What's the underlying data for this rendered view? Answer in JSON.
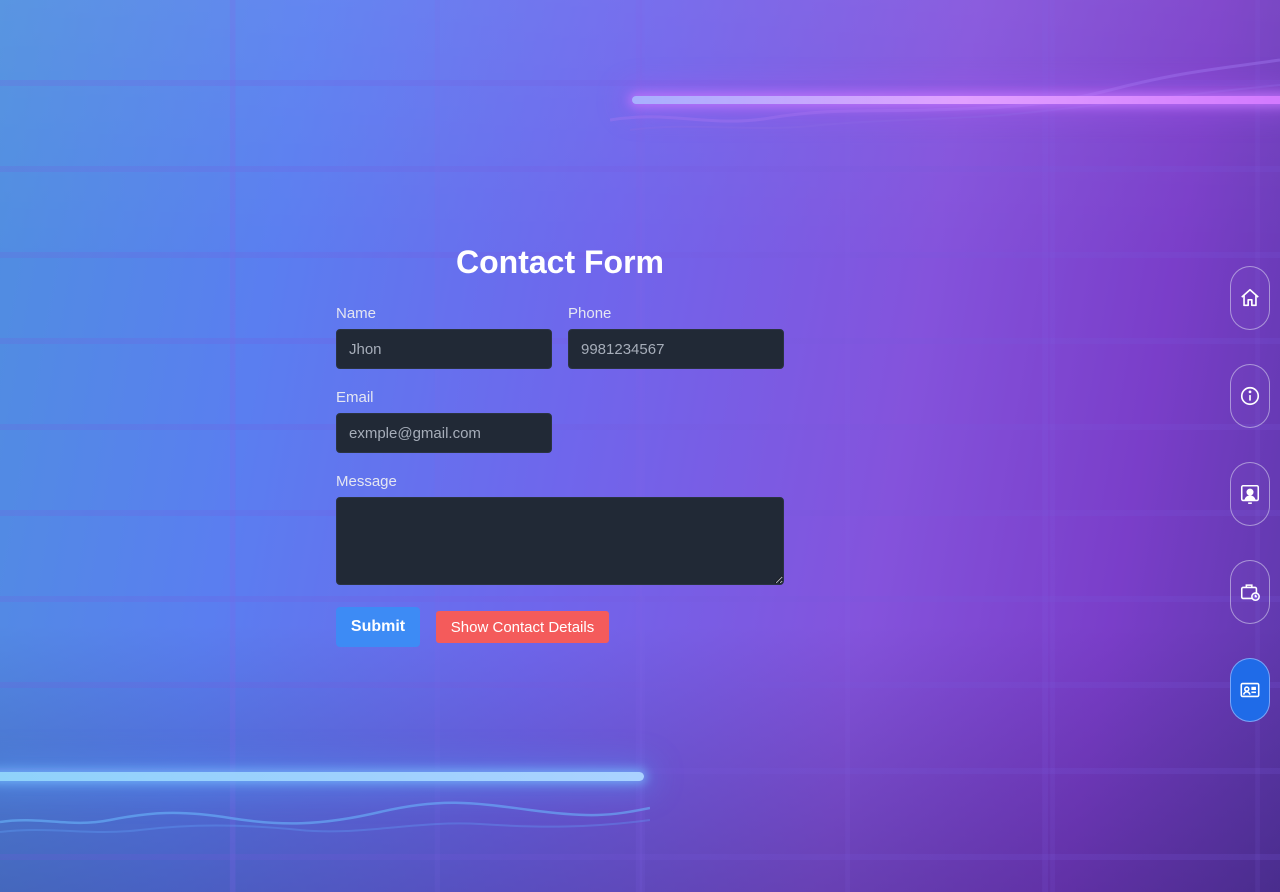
{
  "form": {
    "title": "Contact Form",
    "name": {
      "label": "Name",
      "placeholder": "Jhon"
    },
    "phone": {
      "label": "Phone",
      "placeholder": "9981234567"
    },
    "email": {
      "label": "Email",
      "placeholder": "exmple@gmail.com"
    },
    "message": {
      "label": "Message",
      "value": ""
    },
    "submit_label": "Submit",
    "show_details_label": "Show Contact Details"
  },
  "side_nav": {
    "items": [
      {
        "icon": "home-icon",
        "active": false
      },
      {
        "icon": "info-icon",
        "active": false
      },
      {
        "icon": "portfolio-icon",
        "active": false
      },
      {
        "icon": "briefcase-clock-icon",
        "active": false
      },
      {
        "icon": "contact-card-icon",
        "active": true
      }
    ]
  },
  "colors": {
    "input_bg": "#212936",
    "submit_bg": "#3d8bf5",
    "show_details_bg": "#f45b5b",
    "active_nav_bg": "#1f6be8"
  }
}
